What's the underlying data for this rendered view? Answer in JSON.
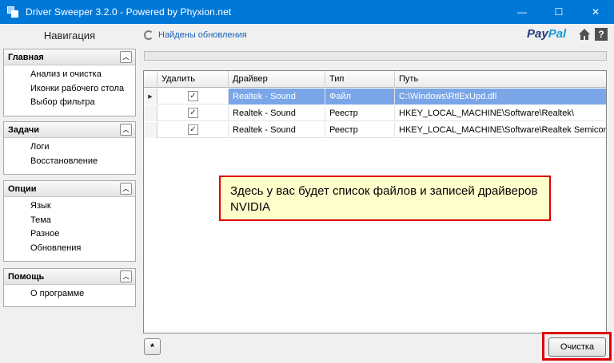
{
  "window": {
    "title": "Driver Sweeper 3.2.0 - Powered by Phyxion.net",
    "minimize": "—",
    "maximize": "☐",
    "close": "✕"
  },
  "navigation": {
    "title": "Навигация",
    "panels": [
      {
        "header": "Главная",
        "items": [
          "Анализ и очистка",
          "Иконки рабочего стола",
          "Выбор фильтра"
        ]
      },
      {
        "header": "Задачи",
        "items": [
          "Логи",
          "Восстановление"
        ]
      },
      {
        "header": "Опции",
        "items": [
          "Язык",
          "Тема",
          "Разное",
          "Обновления"
        ]
      },
      {
        "header": "Помощь",
        "items": [
          "О программе"
        ]
      }
    ]
  },
  "toolbar": {
    "updates_link": "Найдены обновления",
    "paypal_a": "Pay",
    "paypal_b": "Pal",
    "help": "?"
  },
  "progress": 0,
  "table": {
    "columns": [
      "Удалить",
      "Драйвер",
      "Тип",
      "Путь"
    ],
    "rows": [
      {
        "delete": true,
        "driver": "Realtek - Sound",
        "type": "Файл",
        "path": "C:\\Windows\\RtlExUpd.dll"
      },
      {
        "delete": true,
        "driver": "Realtek - Sound",
        "type": "Реестр",
        "path": "HKEY_LOCAL_MACHINE\\Software\\Realtek\\"
      },
      {
        "delete": true,
        "driver": "Realtek - Sound",
        "type": "Реестр",
        "path": "HKEY_LOCAL_MACHINE\\Software\\Realtek Semicond..."
      }
    ],
    "checkmark": "✓",
    "row_marker": "▶"
  },
  "annotation": {
    "text": "Здесь у вас будет список файлов и записей драйверов NVIDIA"
  },
  "bottom": {
    "small_button": "*",
    "clean_button": "Очистка"
  },
  "colors": {
    "titlebar": "#0078d7",
    "selection": "#7aa6e8",
    "highlight_border": "#e00000",
    "annotation_bg": "#ffffcc"
  }
}
